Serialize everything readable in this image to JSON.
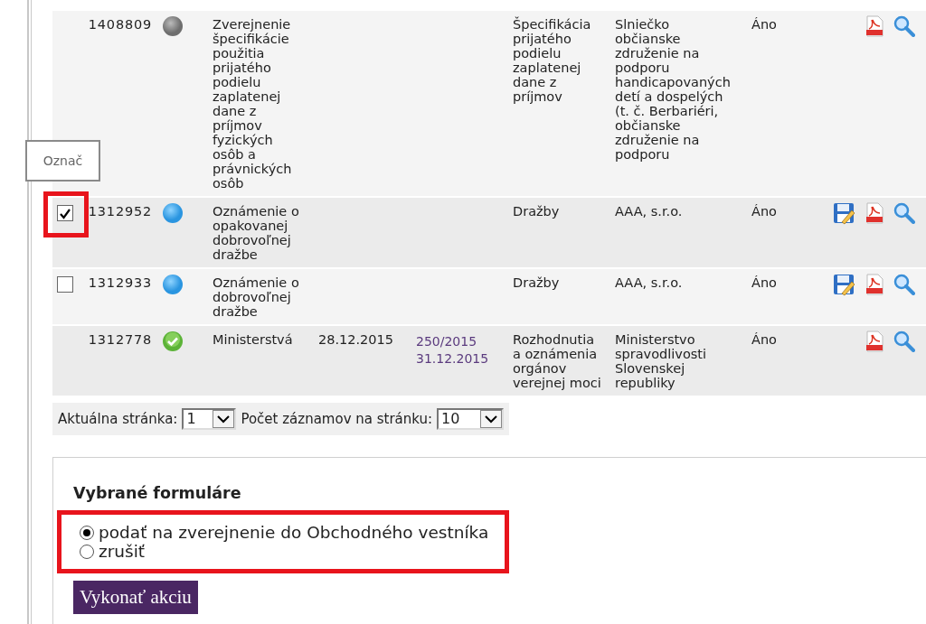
{
  "table": {
    "rows": [
      {
        "checkbox": null,
        "id": "1408809",
        "status": {
          "kind": "grey"
        },
        "title": "Zverejnenie špecifikácie použitia prijatého podielu zaplatenej dane z príjmov fyzických osôb a právnických osôb",
        "date": "",
        "links": [],
        "category": "Špecifikácia prijatého podielu zaplatenej dane z príjmov",
        "publisher": "Slniečko občianske združenie na podporu handicapovaných detí a dospelých (t. č. Berbariéri, občianske združenie na podporu",
        "published": "Áno",
        "actions": [
          {
            "kind": "pdf"
          },
          {
            "kind": "view"
          }
        ],
        "highlighted": false
      },
      {
        "checkbox": {
          "checked": true
        },
        "id": "1312952",
        "status": {
          "kind": "blue"
        },
        "title": "Oznámenie o opakovanej dobrovoľnej dražbe",
        "date": "",
        "links": [],
        "category": "Dražby",
        "publisher": "AAA, s.r.o.",
        "published": "Áno",
        "actions": [
          {
            "kind": "edit"
          },
          {
            "kind": "pdf"
          },
          {
            "kind": "view"
          }
        ],
        "highlighted": true
      },
      {
        "checkbox": {
          "checked": false
        },
        "id": "1312933",
        "status": {
          "kind": "blue"
        },
        "title": "Oznámenie o dobrovoľnej dražbe",
        "date": "",
        "links": [],
        "category": "Dražby",
        "publisher": "AAA, s.r.o.",
        "published": "Áno",
        "actions": [
          {
            "kind": "edit"
          },
          {
            "kind": "pdf"
          },
          {
            "kind": "view"
          }
        ],
        "highlighted": false
      },
      {
        "checkbox": null,
        "id": "1312778",
        "status": {
          "kind": "done"
        },
        "title": "Ministerstvá",
        "date": "28.12.2015",
        "links": [
          "250/2015",
          "31.12.2015"
        ],
        "category": "Rozhodnutia a oznámenia orgánov verejnej moci",
        "publisher": "Ministerstvo spravodlivosti Slovenskej republiky",
        "published": "Áno",
        "actions": [
          {
            "kind": "pdf"
          },
          {
            "kind": "view"
          }
        ],
        "highlighted": false
      }
    ]
  },
  "tooltip": "Označ",
  "pager": {
    "page_label": "Aktuálna stránka:",
    "page_value": "1",
    "size_label": "Počet záznamov na stránku:",
    "size_value": "10"
  },
  "form": {
    "title": "Vybrané formuláre",
    "options": [
      {
        "label": "podať na zverejnenie do Obchodného vestníka",
        "selected": true
      },
      {
        "label": "zrušiť",
        "selected": false
      }
    ],
    "options_highlighted": true,
    "button": "Vykonať akciu"
  }
}
